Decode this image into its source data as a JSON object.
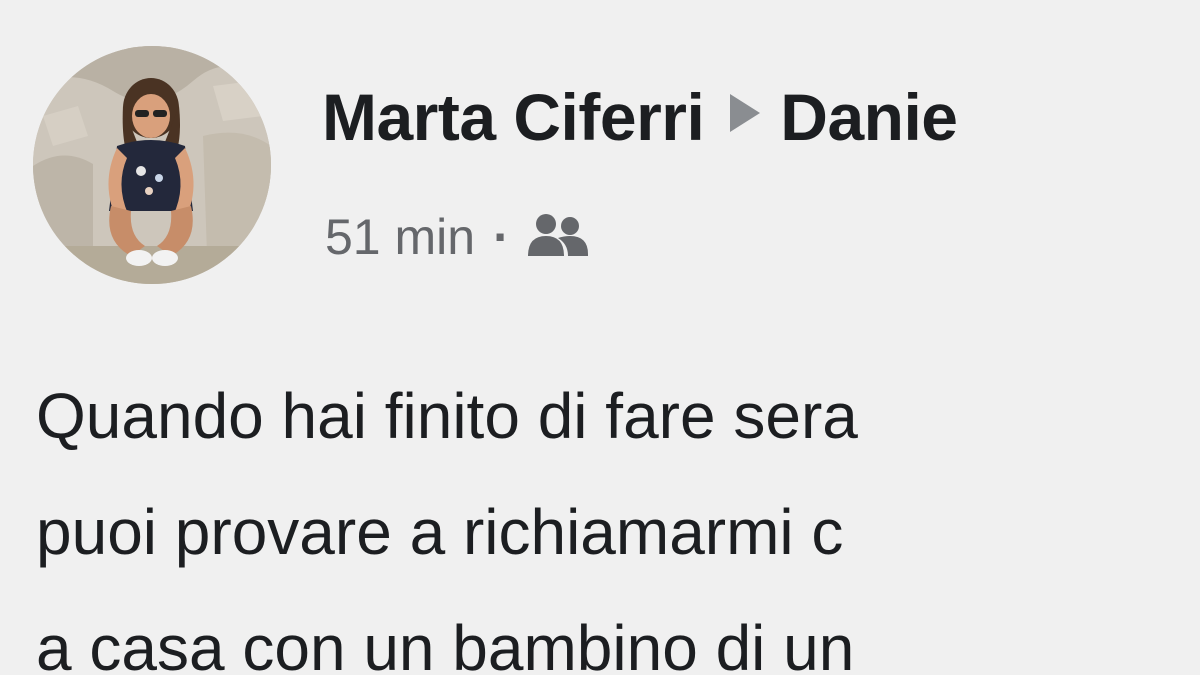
{
  "post": {
    "author_name": "Marta Ciferri",
    "recipient_name": "Danie",
    "timestamp": "51 min",
    "separator": "·",
    "audience_icon": "friends-icon",
    "text_lines": [
      "Quando hai finito di fare sera",
      "puoi provare a richiamarmi c",
      "a casa con un bambino di un"
    ]
  },
  "colors": {
    "background": "#f0f0f0",
    "text": "#1c1e21",
    "secondary_text": "#65676b",
    "arrow": "#8a8d91"
  }
}
